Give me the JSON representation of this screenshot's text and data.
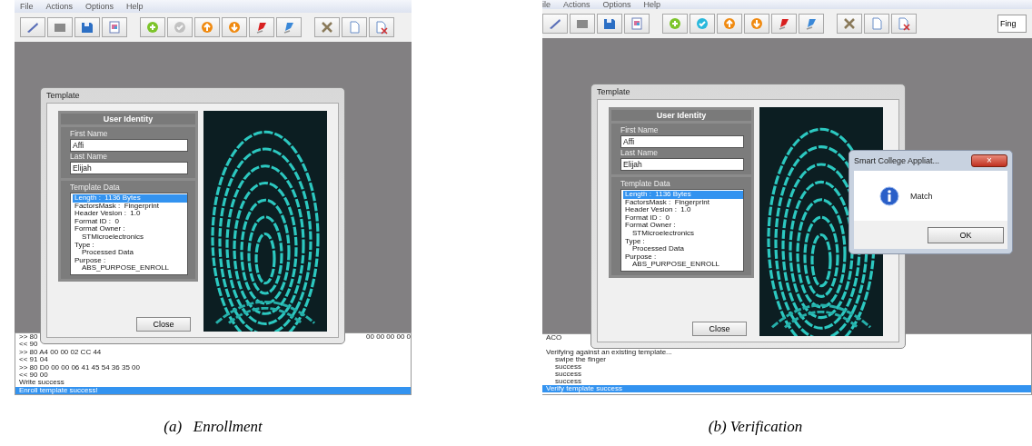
{
  "panels": [
    {
      "menu": [
        "File",
        "Actions",
        "Options",
        "Help"
      ],
      "toolbar": [
        {
          "disabled": false
        },
        {
          "disabled": false
        },
        {
          "disabled": false
        },
        {
          "disabled": false
        },
        {
          "disabled": false
        },
        {
          "disabled": true
        },
        {
          "disabled": false
        },
        {
          "disabled": false
        },
        {
          "disabled": false
        },
        {
          "disabled": false
        },
        {
          "disabled": false
        },
        {
          "disabled": false
        },
        {
          "disabled": false
        }
      ],
      "template_dialog": {
        "title": "Template",
        "section": "User Identity",
        "first_name_label": "First Name",
        "first_name": "Affi",
        "last_name_label": "Last Name",
        "last_name": "Elijah",
        "data_label": "Template Data",
        "data_items": [
          {
            "text": "Length :  1136 Bytes",
            "selected": true,
            "indented": false
          },
          {
            "text": "FactorsMask :  Fingerprint",
            "selected": false,
            "indented": false
          },
          {
            "text": "Header Vesion :  1.0",
            "selected": false,
            "indented": false
          },
          {
            "text": "Format ID :  0",
            "selected": false,
            "indented": false
          },
          {
            "text": "Format Owner :",
            "selected": false,
            "indented": false
          },
          {
            "text": "STMicroelectronics",
            "selected": false,
            "indented": true
          },
          {
            "text": "Type :",
            "selected": false,
            "indented": false
          },
          {
            "text": "Processed Data",
            "selected": false,
            "indented": true
          },
          {
            "text": "Purpose :",
            "selected": false,
            "indented": false
          },
          {
            "text": "ABS_PURPOSE_ENROLL",
            "selected": false,
            "indented": true
          }
        ],
        "close_button": "Close"
      },
      "log": [
        {
          "text": ">> 80",
          "tail": "00 00 00 00 0",
          "selected": false,
          "indented": false
        },
        {
          "text": "<< 90",
          "selected": false,
          "indented": false
        },
        {
          "text": ">> 80 A4 00 00 02 CC 44",
          "selected": false,
          "indented": false
        },
        {
          "text": "<< 91 04",
          "selected": false,
          "indented": false
        },
        {
          "text": ">> 80 D0 00 00 06 41 45 54 36 35 00",
          "selected": false,
          "indented": false
        },
        {
          "text": "<< 90 00",
          "selected": false,
          "indented": false
        },
        {
          "text": "Write success",
          "selected": false,
          "indented": false
        },
        {
          "text": "Enroll template success!",
          "selected": true,
          "indented": false
        }
      ],
      "caption": "(a)   Enrollment"
    },
    {
      "menu": [
        "ile",
        "Actions",
        "Options",
        "Help"
      ],
      "toolbar": [
        {
          "disabled": false
        },
        {
          "disabled": false
        },
        {
          "disabled": false
        },
        {
          "disabled": false
        },
        {
          "disabled": false
        },
        {
          "disabled": false
        },
        {
          "disabled": false
        },
        {
          "disabled": false
        },
        {
          "disabled": false
        },
        {
          "disabled": false
        },
        {
          "disabled": false
        },
        {
          "disabled": false
        },
        {
          "disabled": false
        }
      ],
      "toolbar_field": {
        "value": "Fing"
      },
      "template_dialog": {
        "title": "Template",
        "section": "User Identity",
        "first_name_label": "First Name",
        "first_name": "Affi",
        "last_name_label": "Last Name",
        "last_name": "Elijah",
        "data_label": "Template Data",
        "data_items": [
          {
            "text": "Length :  1136 Bytes",
            "selected": true,
            "indented": false
          },
          {
            "text": "FactorsMask :  Fingerprint",
            "selected": false,
            "indented": false
          },
          {
            "text": "Header Vesion :  1.0",
            "selected": false,
            "indented": false
          },
          {
            "text": "Format ID :  0",
            "selected": false,
            "indented": false
          },
          {
            "text": "Format Owner :",
            "selected": false,
            "indented": false
          },
          {
            "text": "STMicroelectronics",
            "selected": false,
            "indented": true
          },
          {
            "text": "Type :",
            "selected": false,
            "indented": false
          },
          {
            "text": "Processed Data",
            "selected": false,
            "indented": true
          },
          {
            "text": "Purpose :",
            "selected": false,
            "indented": false
          },
          {
            "text": "ABS_PURPOSE_ENROLL",
            "selected": false,
            "indented": true
          }
        ],
        "close_button": "Close"
      },
      "message_box": {
        "title": "Smart College Appliat...",
        "close": "×",
        "message": "Match",
        "ok_button": "OK"
      },
      "log": [
        {
          "text": "ACO",
          "selected": false,
          "indented": false,
          "gap_after": true
        },
        {
          "text": "Verifying against an existing template...",
          "selected": false,
          "indented": false
        },
        {
          "text": "swipe the finger",
          "selected": false,
          "indented": true
        },
        {
          "text": "success",
          "selected": false,
          "indented": true
        },
        {
          "text": "success",
          "selected": false,
          "indented": true
        },
        {
          "text": "success",
          "selected": false,
          "indented": true
        },
        {
          "text": "Verify template success",
          "selected": true,
          "indented": false
        }
      ],
      "caption": "(b) Verification"
    }
  ]
}
